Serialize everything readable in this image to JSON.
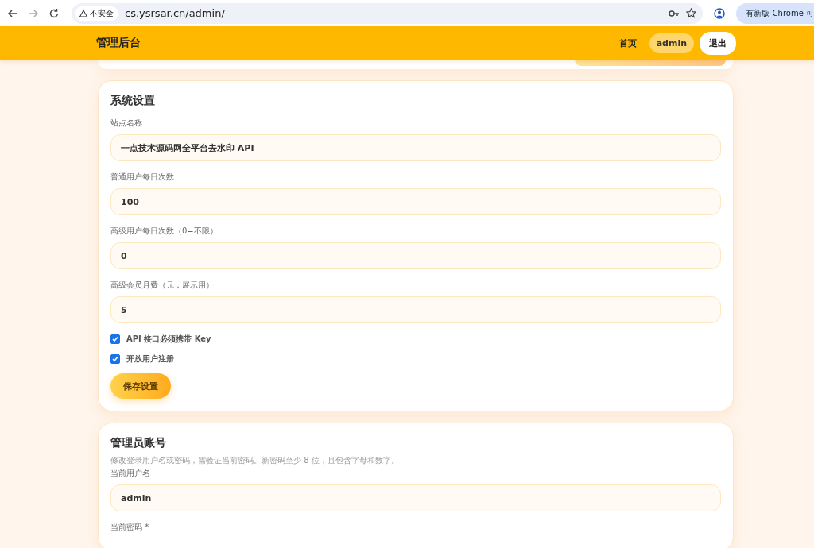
{
  "browser": {
    "security_label": "不安全",
    "url": "cs.ysrsar.cn/admin/",
    "update_label": "有新版 Chrome 可"
  },
  "header": {
    "title": "管理后台",
    "nav_link": "首页",
    "user": "admin",
    "logout": "退出"
  },
  "settings": {
    "title": "系统设置",
    "fields": [
      {
        "label": "站点名称",
        "value": "一点技术源码网全平台去水印 API"
      },
      {
        "label": "普通用户每日次数",
        "value": "100"
      },
      {
        "label": "高级用户每日次数（0=不限）",
        "value": "0"
      },
      {
        "label": "高级会员月费（元，展示用）",
        "value": "5"
      }
    ],
    "checkboxes": [
      {
        "label": "API 接口必须携带 Key",
        "checked": true
      },
      {
        "label": "开放用户注册",
        "checked": true
      }
    ],
    "save_button": "保存设置"
  },
  "admin_account": {
    "title": "管理员账号",
    "hint": "修改登录用户名或密码，需验证当前密码。新密码至少 8 位，且包含字母和数字。",
    "fields": [
      {
        "label": "当前用户名",
        "value": "admin"
      }
    ],
    "cut_label": "当前密码 *"
  }
}
